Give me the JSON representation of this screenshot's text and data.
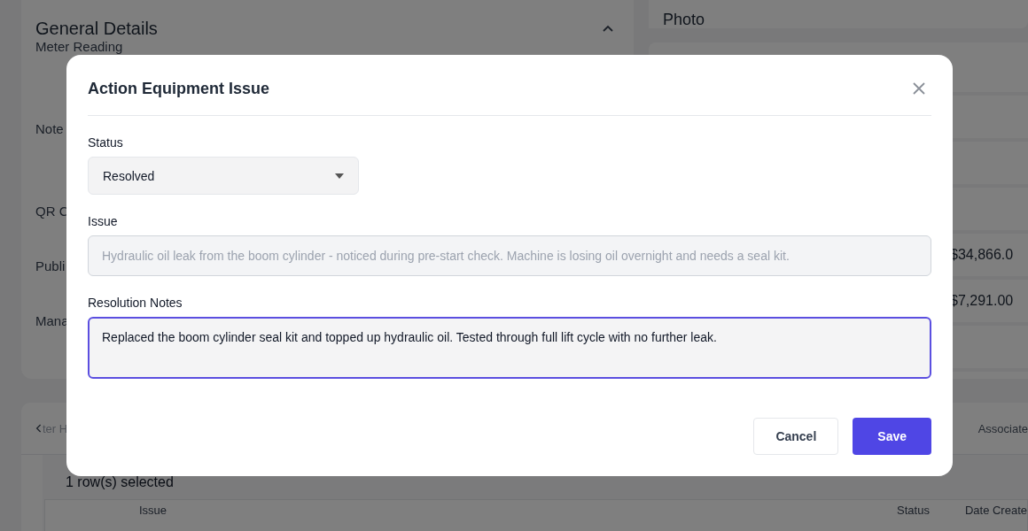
{
  "background": {
    "general_details": {
      "title": "General Details",
      "expanded": true,
      "labels": [
        "Meter Reading",
        "Note",
        "QR C",
        "Publi",
        "Mana"
      ]
    },
    "photo": {
      "title": "Photo"
    },
    "amounts": [
      "$34,866.0",
      "$7,291.00"
    ],
    "tabs": [
      {
        "label": "ter H"
      },
      {
        "label": "Associate"
      }
    ],
    "selection": "1 row(s) selected",
    "columns": [
      "Issue",
      "Status",
      "Date Create"
    ]
  },
  "dialog": {
    "title": "Action Equipment Issue",
    "fields": [
      {
        "kind": "select",
        "label": "Status",
        "value": "Resolved"
      },
      {
        "kind": "input",
        "label": "Issue",
        "value": "Hydraulic oil leak from the boom cylinder - noticed during pre-start check. Machine is losing oil overnight and needs a seal kit.",
        "disabled": true
      },
      {
        "kind": "textarea",
        "label": "Resolution Notes",
        "value": "Replaced the boom cylinder seal kit and topped up hydraulic oil. Tested through full lift cycle with no further leak.",
        "focused": true
      }
    ],
    "buttons": [
      {
        "kind": "secondary",
        "label": "Cancel"
      },
      {
        "kind": "primary",
        "label": "Save"
      }
    ]
  }
}
